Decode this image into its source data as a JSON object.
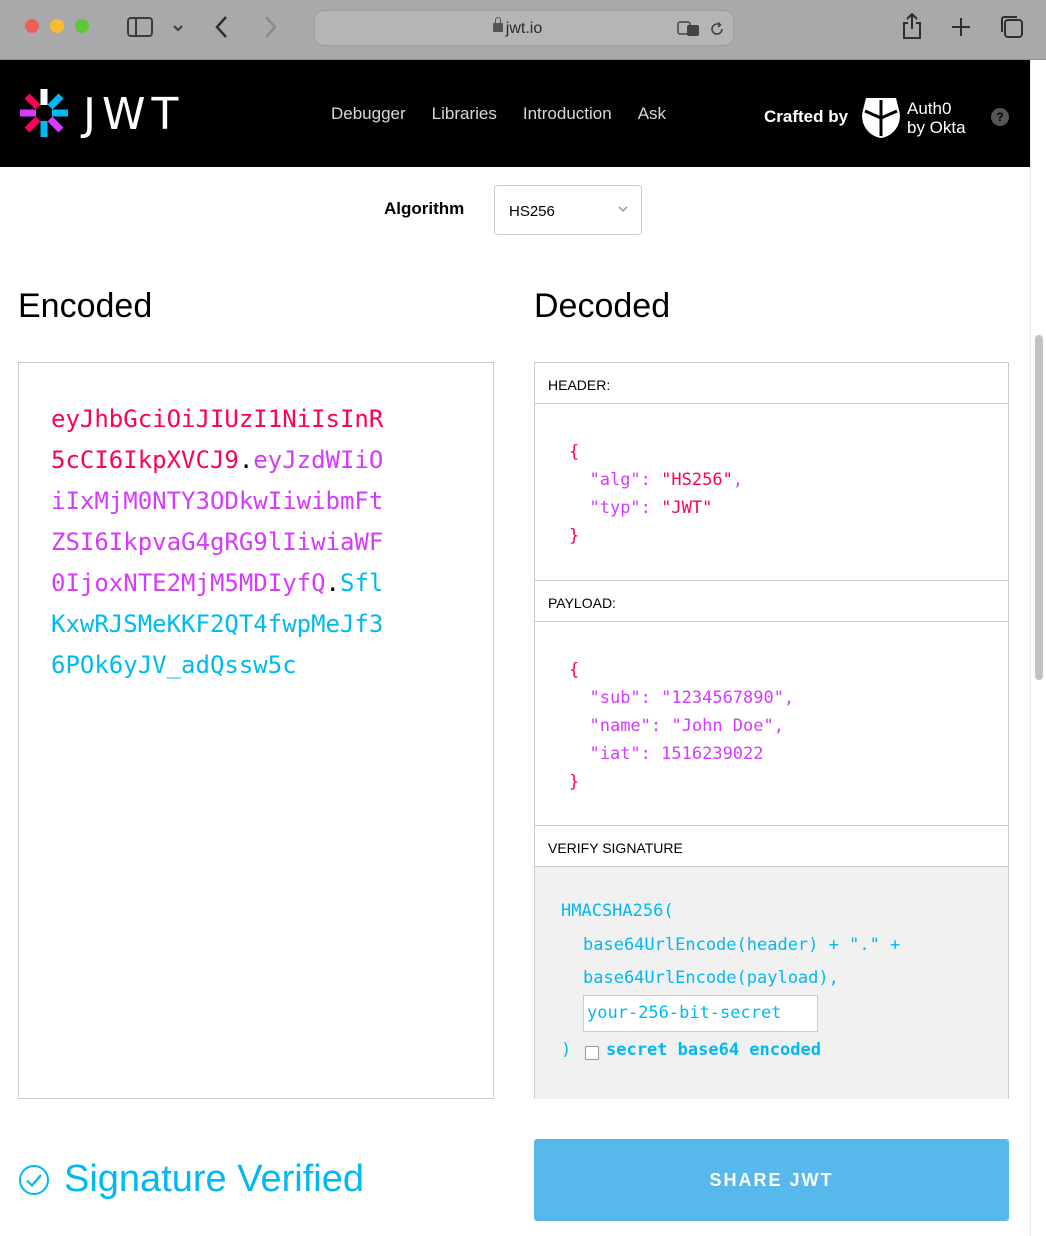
{
  "browser": {
    "url": "jwt.io",
    "icons": [
      "sidebar-icon",
      "chevron-down-icon",
      "back-icon",
      "forward-icon",
      "translate-icon",
      "reload-icon",
      "share-icon",
      "new-tab-icon",
      "tabs-overview-icon"
    ]
  },
  "navbar": {
    "logo_text": "JWT",
    "links": [
      "Debugger",
      "Libraries",
      "Introduction",
      "Ask"
    ],
    "crafted_by": "Crafted by",
    "auth0_line1": "Auth0",
    "auth0_line2": "by Okta",
    "help": "?"
  },
  "algorithm": {
    "label": "Algorithm",
    "selected": "HS256"
  },
  "encoded": {
    "heading": "Encoded",
    "header_part": "eyJhbGciOiJIUzI1NiIsInR5cCI6IkpXVCJ9",
    "payload_part": "eyJzdWIiOiIxMjM0NTY3ODkwIiwibmFtZSI6IkpvaG4gRG9lIiwiaWF0IjoxNTE2MjM5MDIyfQ",
    "signature_part": "SflKxwRJSMeKKF2QT4fwpMeJf36POk6yJV_adQssw5c",
    "dot": "."
  },
  "decoded": {
    "heading": "Decoded",
    "header": {
      "title": "HEADER:",
      "open": "{",
      "close": "}",
      "lines": [
        {
          "key": "\"alg\"",
          "sep": ": ",
          "value": "\"HS256\"",
          "end": ","
        },
        {
          "key": "\"typ\"",
          "sep": ": ",
          "value": "\"JWT\"",
          "end": ""
        }
      ]
    },
    "payload": {
      "title": "PAYLOAD:",
      "open": "{",
      "close": "}",
      "lines": [
        {
          "key": "\"sub\"",
          "sep": ": ",
          "value": "\"1234567890\"",
          "end": ","
        },
        {
          "key": "\"name\"",
          "sep": ": ",
          "value": "\"John Doe\"",
          "end": ","
        },
        {
          "key": "\"iat\"",
          "sep": ": ",
          "value": "1516239022",
          "end": ""
        }
      ]
    },
    "verify": {
      "title": "VERIFY SIGNATURE",
      "line1": "HMACSHA256(",
      "line2": "base64UrlEncode(header) + \".\" +",
      "line3": "base64UrlEncode(payload),",
      "secret_value": "your-256-bit-secret",
      "close": ")",
      "checkbox_label": "secret base64 encoded"
    }
  },
  "status": {
    "verified_text": "Signature Verified",
    "share_label": "SHARE JWT"
  }
}
